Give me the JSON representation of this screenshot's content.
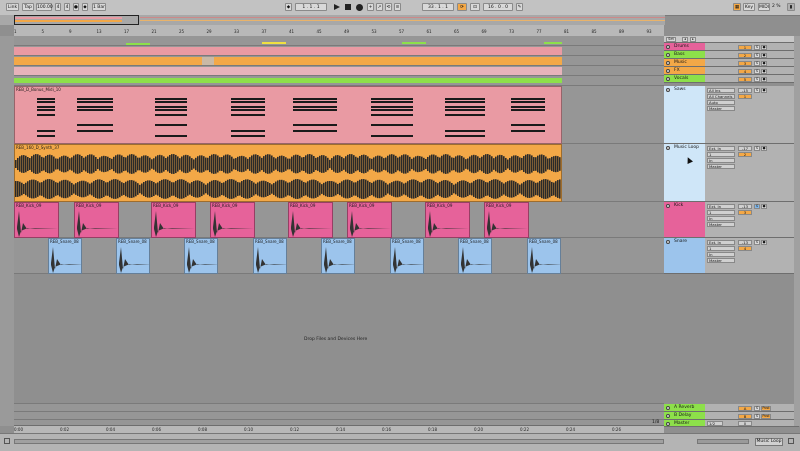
{
  "control_bar": {
    "link": "Link",
    "tap": "Tap",
    "tempo": "100.00",
    "time_sig_num": "4",
    "time_sig_den": "4",
    "metronome": "●",
    "quantize": "1 Bar",
    "arrangement_position": "1 . 1 . 1",
    "loop_start": "33 . 1 . 1",
    "loop_length": "16 . 0 . 0",
    "key": "Key",
    "midi": "MIDI",
    "cpu": "2 %"
  },
  "ruler": {
    "bars": [
      "1",
      "5",
      "9",
      "13",
      "17",
      "21",
      "25",
      "29",
      "33",
      "37",
      "41",
      "45",
      "49",
      "53",
      "57",
      "61",
      "65",
      "69",
      "73",
      "77",
      "81",
      "85",
      "89",
      "93"
    ],
    "times": [
      "0:00",
      "0:02",
      "0:04",
      "0:06",
      "0:08",
      "0:10",
      "0:12",
      "0:14",
      "0:16",
      "0:18",
      "0:20",
      "0:22",
      "0:24",
      "0:26"
    ],
    "zoom_label": "1/8"
  },
  "drop_zone": "Drop Files and Devices Here",
  "group_tracks": [
    {
      "name": "Drums",
      "color": "#e6629a",
      "vol": "0",
      "pan": "1"
    },
    {
      "name": "Bass",
      "color": "#8de04a",
      "vol": "0",
      "pan": "2"
    },
    {
      "name": "Music",
      "color": "#f3a847",
      "vol": "0",
      "pan": "3"
    },
    {
      "name": "FX",
      "color": "#f3a847",
      "vol": "10",
      "pan": "4"
    },
    {
      "name": "Vocals",
      "color": "#8de04a",
      "vol": "-12",
      "pan": "5"
    }
  ],
  "tracks": [
    {
      "name": "Saws",
      "clip": "REB_D_Bonus_Midi_10",
      "input": "All Ins",
      "channel": "All Channels",
      "monitor": "Auto",
      "output": "Master",
      "vol": "-15",
      "pan": "1"
    },
    {
      "name": "Music Loop",
      "clip": "REB_160_D_Synth_37",
      "input": "Ext. In",
      "channel": "1",
      "monitor": "In",
      "output": "Master",
      "vol": "-17",
      "pan": "2"
    },
    {
      "name": "Kick",
      "clip": "REB_Kick_09",
      "input": "Ext. In",
      "channel": "1",
      "monitor": "In",
      "output": "Master",
      "vol": "-13",
      "pan": "3"
    },
    {
      "name": "Snare",
      "clip": "REB_Snare_08",
      "input": "Ext. In",
      "channel": "1",
      "monitor": "In",
      "output": "Master",
      "vol": "-13",
      "pan": "4"
    }
  ],
  "returns": [
    {
      "name": "A Reverb",
      "vol": "A"
    },
    {
      "name": "B Delay",
      "vol": "B"
    }
  ],
  "master": {
    "name": "Master",
    "vol": "0",
    "channel": "1/2"
  },
  "status": {
    "right_label": "Music Loop",
    "set_label": "Set"
  },
  "colors": {
    "pink": "#e6629a",
    "green": "#8de04a",
    "orange": "#f3a847",
    "salmon": "#e99aa3",
    "blue": "#9cc4ec"
  }
}
